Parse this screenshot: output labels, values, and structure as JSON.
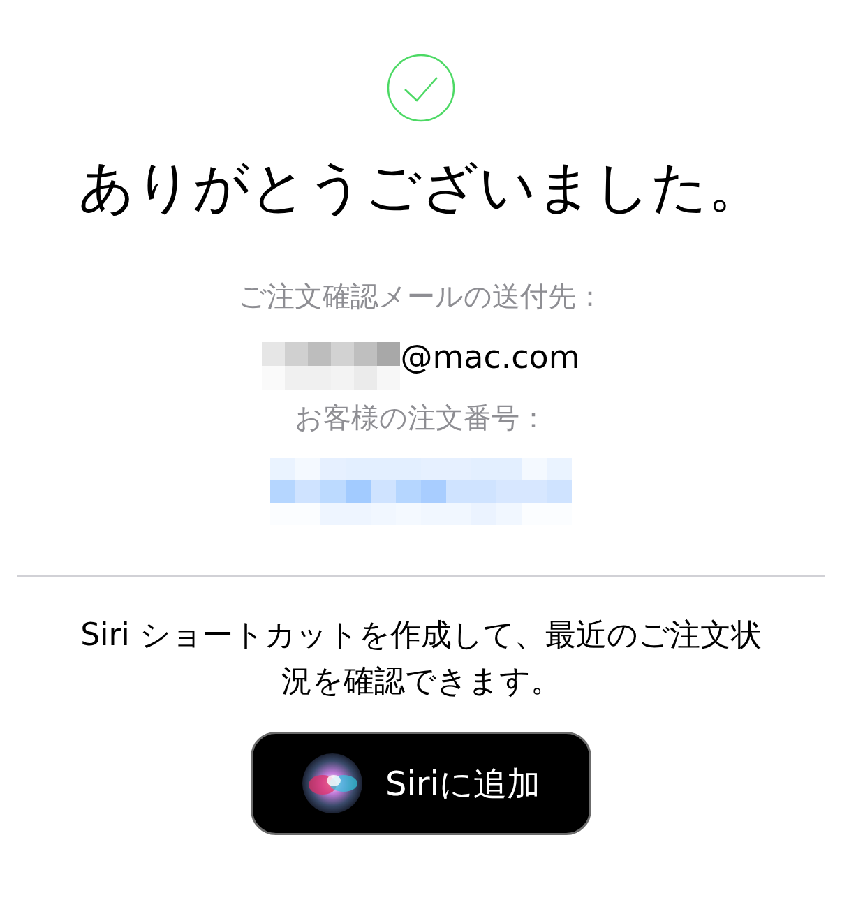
{
  "status": {
    "kind": "success"
  },
  "title": "ありがとうございました。",
  "email_label": "ご注文確認メールの送付先：",
  "email": {
    "text": "@mac.com",
    "redacted": true
  },
  "order_label": "お客様の注文番号：",
  "order_number": {
    "redacted": true
  },
  "siri_text": "Siri ショートカットを作成して、最近のご注文状況を確認できます。",
  "siri_button": {
    "label": "Siriに追加"
  }
}
